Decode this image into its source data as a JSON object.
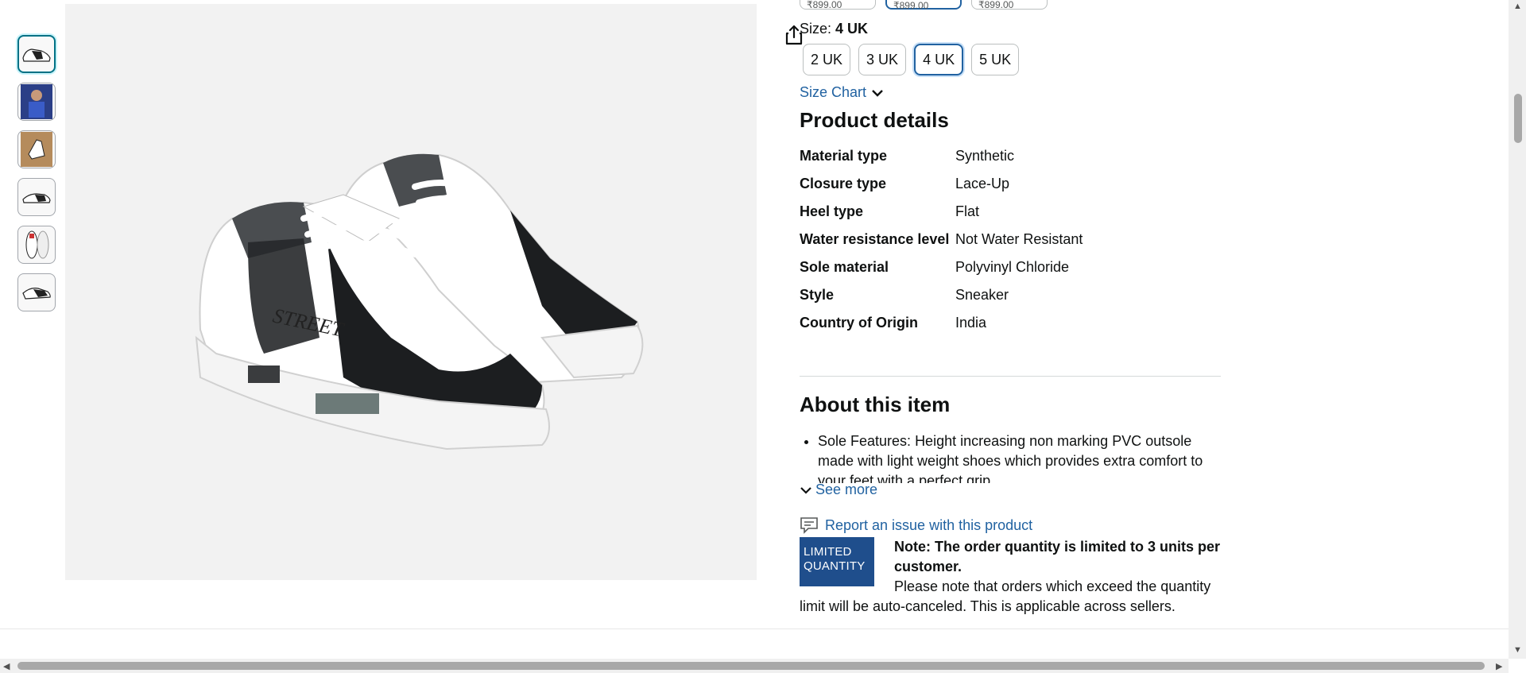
{
  "thumbnails": [
    {
      "name": "thumb-sneaker-pair",
      "selected": true
    },
    {
      "name": "thumb-model-photo",
      "selected": false
    },
    {
      "name": "thumb-sneaker-worn",
      "selected": false
    },
    {
      "name": "thumb-sneaker-side",
      "selected": false
    },
    {
      "name": "thumb-sneaker-top",
      "selected": false
    },
    {
      "name": "thumb-sneaker-angle",
      "selected": false
    }
  ],
  "share_icon": "share-icon",
  "variant_prices": [
    "₹899.00",
    "₹899.00",
    "₹899.00"
  ],
  "size": {
    "label": "Size:",
    "selected": "4 UK",
    "options": [
      "2 UK",
      "3 UK",
      "4 UK",
      "5 UK"
    ]
  },
  "size_chart": "Size Chart",
  "product_details": {
    "title": "Product details",
    "rows": [
      {
        "label": "Material type",
        "value": "Synthetic"
      },
      {
        "label": "Closure type",
        "value": "Lace-Up"
      },
      {
        "label": "Heel type",
        "value": "Flat"
      },
      {
        "label": "Water resistance level",
        "value": "Not Water Resistant"
      },
      {
        "label": "Sole material",
        "value": "Polyvinyl Chloride"
      },
      {
        "label": "Style",
        "value": "Sneaker"
      },
      {
        "label": "Country of Origin",
        "value": "India"
      }
    ]
  },
  "about": {
    "title": "About this item",
    "bullets": [
      "Sole Features: Height increasing non marking PVC outsole made with light weight shoes which provides extra comfort to your feet with a perfect grip"
    ],
    "see_more": "See more"
  },
  "report_link": "Report an issue with this product",
  "limited_badge": {
    "line1": "LIMITED",
    "line2": "QUANTITY"
  },
  "note": {
    "label": "Note",
    "bold_text": ": The order quantity is limited to 3 units per customer.",
    "text": "Please note that orders which exceed the quantity limit will be auto-canceled. This is applicable across sellers."
  },
  "colors": {
    "link": "#2162a1",
    "selected_border": "#2162a1",
    "badge_bg": "#1f4e8c"
  }
}
